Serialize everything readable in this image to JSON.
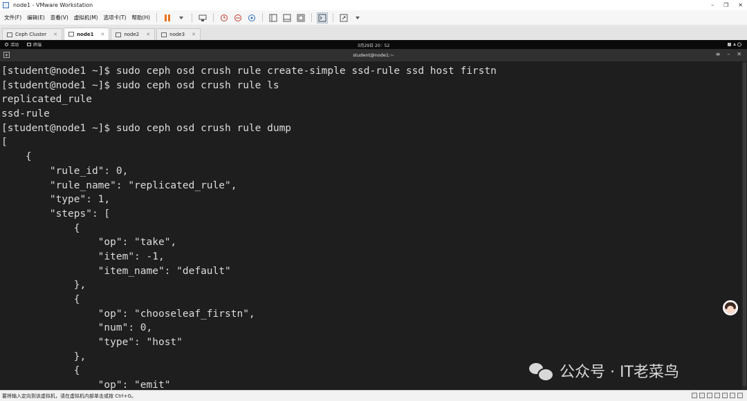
{
  "window": {
    "title": "node1 - VMware Workstation",
    "controls": [
      "–",
      "❐",
      "✕"
    ]
  },
  "menu": {
    "items": [
      "文件(F)",
      "编辑(E)",
      "查看(V)",
      "虚拟机(M)",
      "选项卡(T)",
      "帮助(H)"
    ]
  },
  "tabs": [
    {
      "label": "Ceph Cluster",
      "close": "✕",
      "active": false
    },
    {
      "label": "node1",
      "close": "✕",
      "active": true
    },
    {
      "label": "node2",
      "close": "✕",
      "active": false
    },
    {
      "label": "node3",
      "close": "✕",
      "active": false
    }
  ],
  "gnome": {
    "activities": "活动",
    "terminal": "终端",
    "clock": "3月29日 20：52"
  },
  "terminal": {
    "title": "student@node1:~",
    "lines": [
      "[student@node1 ~]$ sudo ceph osd crush rule create-simple ssd-rule ssd host firstn",
      "[student@node1 ~]$ sudo ceph osd crush rule ls",
      "replicated_rule",
      "ssd-rule",
      "[student@node1 ~]$ sudo ceph osd crush rule dump",
      "[",
      "    {",
      "        \"rule_id\": 0,",
      "        \"rule_name\": \"replicated_rule\",",
      "        \"type\": 1,",
      "        \"steps\": [",
      "            {",
      "                \"op\": \"take\",",
      "                \"item\": -1,",
      "                \"item_name\": \"default\"",
      "            },",
      "            {",
      "                \"op\": \"chooseleaf_firstn\",",
      "                \"num\": 0,",
      "                \"type\": \"host\"",
      "            },",
      "            {",
      "                \"op\": \"emit\""
    ]
  },
  "watermark": "公众号 · IT老菜鸟",
  "status": {
    "text": "要将输入定向到该虚拟机，请在虚拟机内部单击或按 Ctrl+G。"
  }
}
